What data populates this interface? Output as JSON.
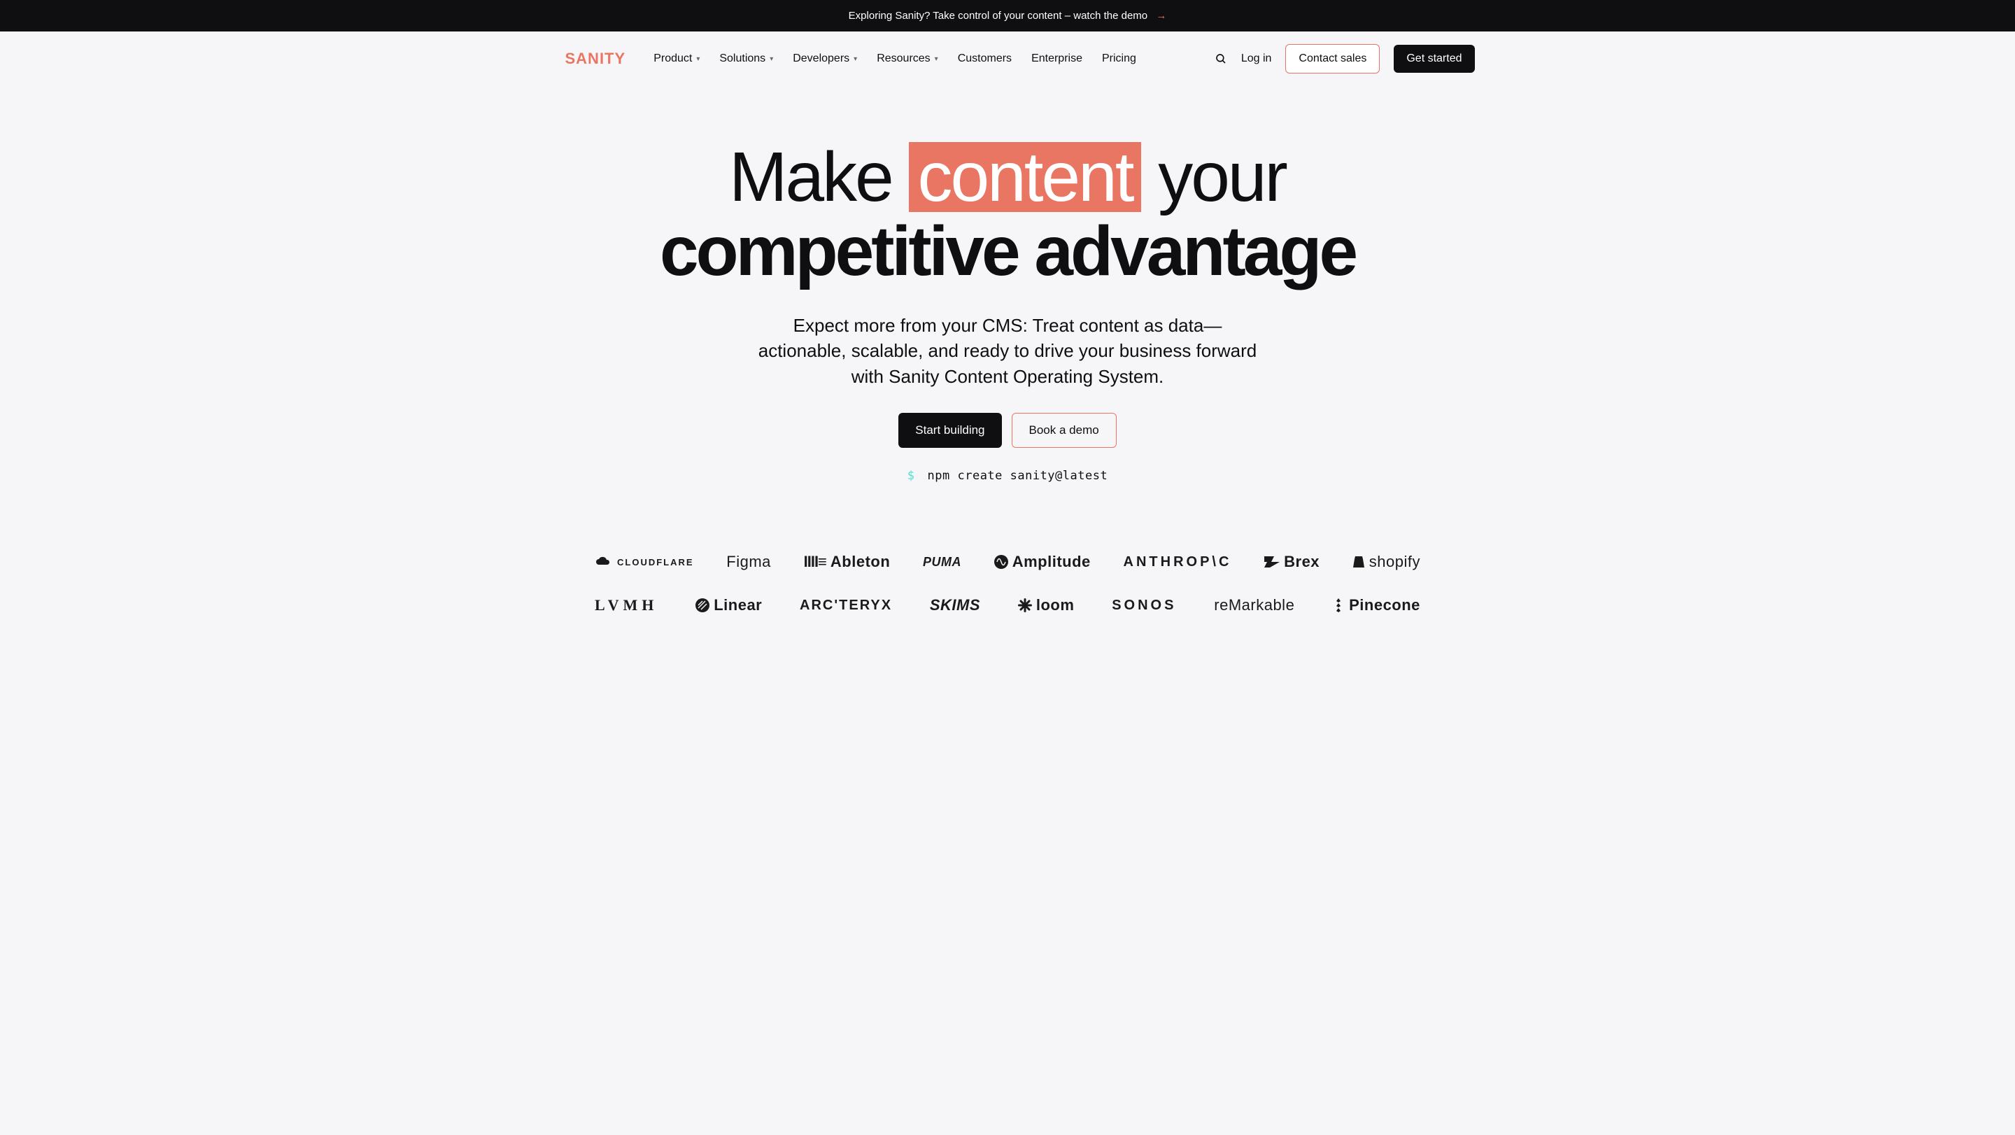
{
  "announce": {
    "text": "Exploring Sanity? Take control of your content – watch the demo"
  },
  "brand": {
    "name": "SANITY"
  },
  "nav": {
    "items": [
      {
        "label": "Product",
        "dropdown": true
      },
      {
        "label": "Solutions",
        "dropdown": true
      },
      {
        "label": "Developers",
        "dropdown": true
      },
      {
        "label": "Resources",
        "dropdown": true
      },
      {
        "label": "Customers",
        "dropdown": false
      },
      {
        "label": "Enterprise",
        "dropdown": false
      },
      {
        "label": "Pricing",
        "dropdown": false
      }
    ]
  },
  "header_actions": {
    "login": "Log in",
    "contact_sales": "Contact sales",
    "get_started": "Get started"
  },
  "hero": {
    "line1_pre": "Make ",
    "line1_hl": "content",
    "line1_post": " your",
    "line2": "competitive advantage",
    "subhead": "Expect more from your CMS: Treat content as data—actionable, scalable, and ready to drive your business forward with Sanity Content Operating System.",
    "cta_primary": "Start building",
    "cta_secondary": "Book a demo",
    "cmd_prompt": "$",
    "cmd_text": "npm create sanity@latest"
  },
  "logos_row1": [
    "CLOUDFLARE",
    "Figma",
    "Ableton",
    "PUMA",
    "Amplitude",
    "ANTHROP\\C",
    "Brex",
    "shopify"
  ],
  "logos_row2": [
    "LVMH",
    "Linear",
    "ARC'TERYX",
    "SKIMS",
    "loom",
    "SONOS",
    "reMarkable",
    "Pinecone"
  ]
}
